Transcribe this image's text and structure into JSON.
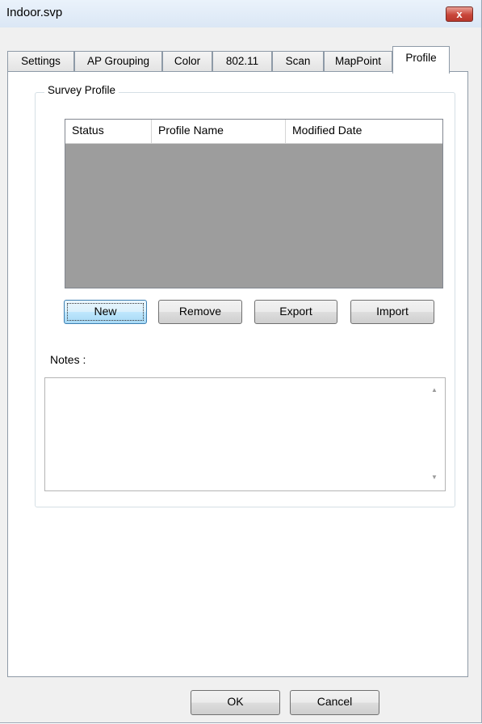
{
  "window": {
    "title": "Indoor.svp",
    "close_glyph": "x"
  },
  "tabs": [
    {
      "label": "Settings",
      "active": false
    },
    {
      "label": "AP Grouping",
      "active": false
    },
    {
      "label": "Color",
      "active": false
    },
    {
      "label": "802.11",
      "active": false
    },
    {
      "label": "Scan",
      "active": false
    },
    {
      "label": "MapPoint",
      "active": false
    },
    {
      "label": "Profile",
      "active": true
    }
  ],
  "survey_profile": {
    "group_label": "Survey Profile",
    "columns": [
      "Status",
      "Profile Name",
      "Modified Date"
    ],
    "rows": []
  },
  "buttons": {
    "new": "New",
    "remove": "Remove",
    "export": "Export",
    "import": "Import"
  },
  "notes": {
    "label": "Notes :",
    "value": ""
  },
  "footer": {
    "ok": "OK",
    "cancel": "Cancel"
  },
  "colors": {
    "grid_background": "#9d9d9d",
    "close_button": "#c9463a",
    "default_button": "#bee6fd"
  },
  "icons": {
    "scroll_up": "scroll-up-icon",
    "scroll_down": "scroll-down-icon"
  }
}
